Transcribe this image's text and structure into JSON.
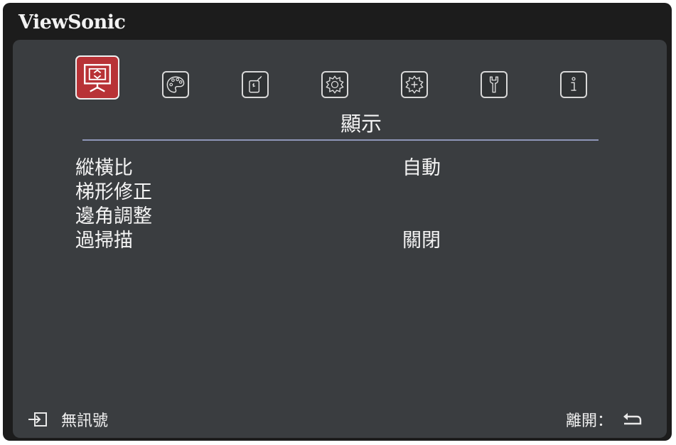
{
  "brand": "ViewSonic",
  "tabs": [
    {
      "icon": "display-icon",
      "active": true
    },
    {
      "icon": "palette-icon",
      "active": false
    },
    {
      "icon": "power-icon",
      "active": false
    },
    {
      "icon": "gear-icon",
      "active": false
    },
    {
      "icon": "advanced-gear-icon",
      "active": false
    },
    {
      "icon": "wrench-icon",
      "active": false
    },
    {
      "icon": "info-icon",
      "active": false
    }
  ],
  "active_tab_title": "顯示",
  "menu": [
    {
      "label": "縱橫比",
      "value": "自動"
    },
    {
      "label": "梯形修正",
      "value": ""
    },
    {
      "label": "邊角調整",
      "value": ""
    },
    {
      "label": "過掃描",
      "value": "關閉"
    }
  ],
  "footer": {
    "source_icon": "input-source-icon",
    "source_label": "無訊號",
    "exit_label": "離開：",
    "exit_icon": "return-arrow-icon"
  },
  "colors": {
    "active_tab": "#b83236",
    "panel": "#3a3d40",
    "frame": "#1c1c1c",
    "rule": "#8e96b8"
  }
}
